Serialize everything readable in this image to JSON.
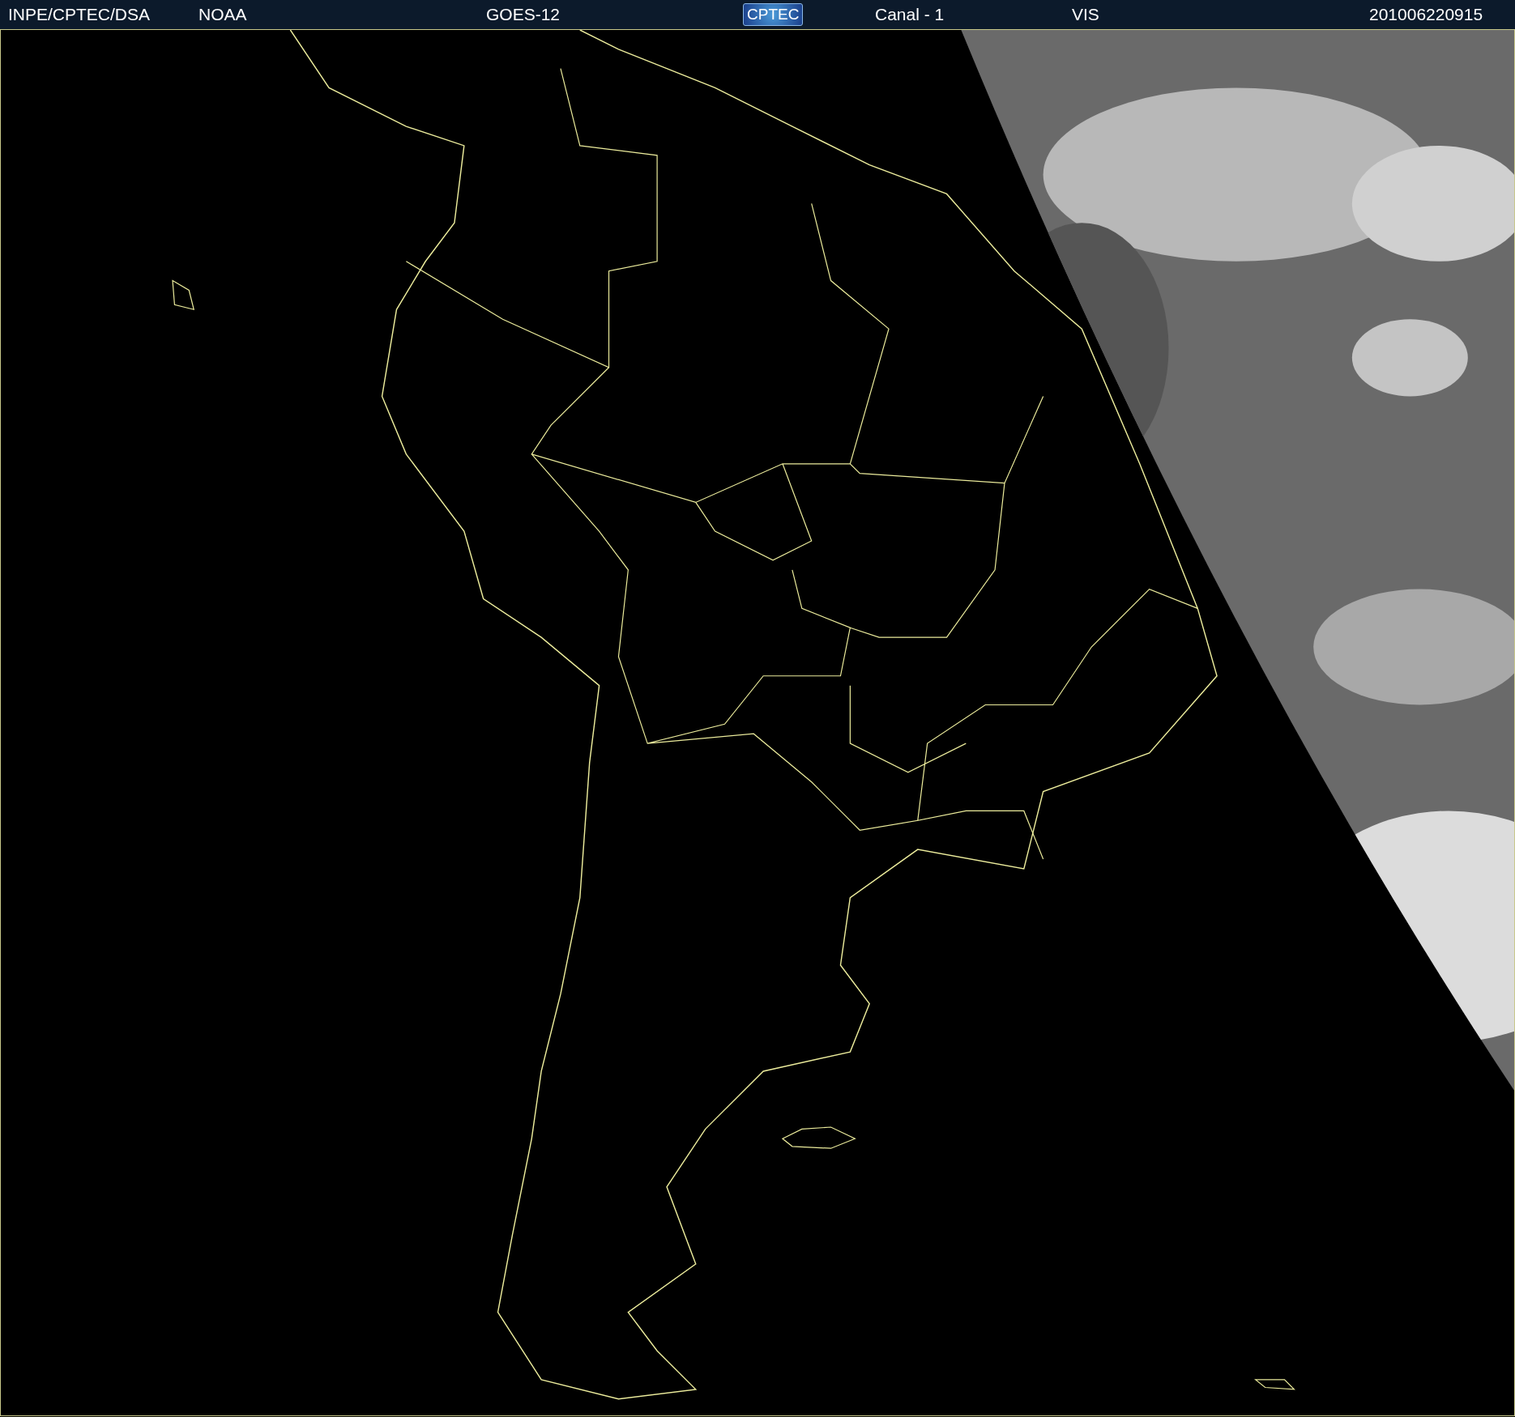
{
  "header": {
    "items": [
      {
        "kind": "text",
        "text": "INPE/CPTEC/DSA"
      },
      {
        "kind": "text",
        "text": "NOAA"
      },
      {
        "kind": "text",
        "text": "GOES-12"
      },
      {
        "kind": "logo",
        "text": "CPTEC"
      },
      {
        "kind": "text",
        "text": "Canal - 1"
      },
      {
        "kind": "text",
        "text": "VIS"
      },
      {
        "kind": "text",
        "text": "201006220915"
      }
    ]
  }
}
